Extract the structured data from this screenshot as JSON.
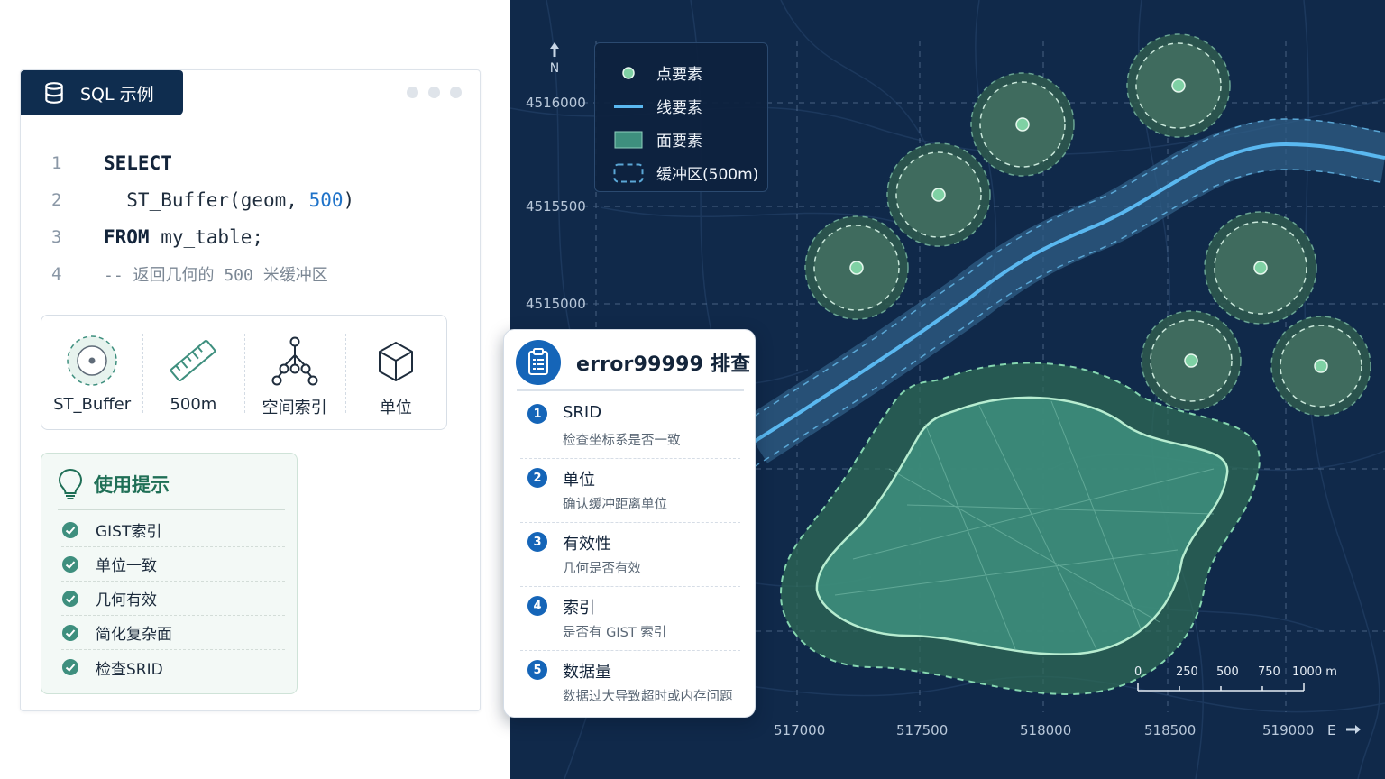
{
  "sql_card": {
    "tab_label": "SQL 示例",
    "code_lines": [
      {
        "num": "1",
        "keyword": "SELECT",
        "rest": ""
      },
      {
        "num": "2",
        "prefix": "  ST_Buffer(geom, ",
        "number": "500",
        "suffix": ")"
      },
      {
        "num": "3",
        "keyword": "FROM",
        "rest": " my_table;"
      },
      {
        "num": "4",
        "comment": "-- 返回几何的 500 米缓冲区"
      }
    ],
    "functions": [
      {
        "label": "ST_Buffer",
        "icon": "buffer-circle-icon"
      },
      {
        "label": "500m",
        "icon": "ruler-icon"
      },
      {
        "label": "空间索引",
        "icon": "spatial-index-tree-icon"
      },
      {
        "label": "单位",
        "icon": "cube-icon"
      }
    ],
    "tips": {
      "title": "使用提示",
      "icon": "lightbulb-icon",
      "items": [
        "GIST索引",
        "单位一致",
        "几何有效",
        "简化复杂面",
        "检查SRID"
      ]
    }
  },
  "error_card": {
    "title": "error99999 排查",
    "icon": "clipboard-icon",
    "items": [
      {
        "num": "1",
        "name": "SRID",
        "desc": "检查坐标系是否一致"
      },
      {
        "num": "2",
        "name": "单位",
        "desc": "确认缓冲距离单位"
      },
      {
        "num": "3",
        "name": "有效性",
        "desc": "几何是否有效"
      },
      {
        "num": "4",
        "name": "索引",
        "desc": "是否有 GIST 索引"
      },
      {
        "num": "5",
        "name": "数据量",
        "desc": "数据过大导致超时或内存问题"
      }
    ]
  },
  "map": {
    "north_label": "N",
    "east_label": "E",
    "y_ticks": [
      "4516000",
      "4515500",
      "4515000"
    ],
    "x_ticks": [
      "517000",
      "517500",
      "518000",
      "518500",
      "519000"
    ],
    "legend": [
      {
        "label": "点要素",
        "symbol": "point"
      },
      {
        "label": "线要素",
        "symbol": "line"
      },
      {
        "label": "面要素",
        "symbol": "polygon"
      },
      {
        "label": "缓冲区(500m)",
        "symbol": "buffer"
      }
    ],
    "scale_labels": [
      "0",
      "250",
      "500",
      "750",
      "1000 m"
    ],
    "colors": {
      "background": "#10294a",
      "line": "#5ab8f0",
      "polygon": "#3e8f7e",
      "point": "#7fd1a4",
      "buffer": "#3f6b5e"
    }
  }
}
